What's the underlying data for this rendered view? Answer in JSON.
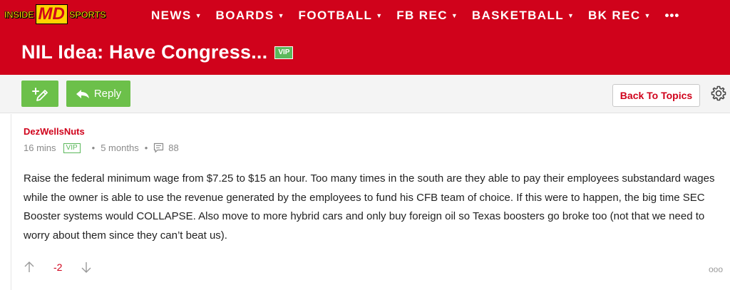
{
  "logo": {
    "left": "INSIDE",
    "mark": "MD",
    "right": "SPORTS"
  },
  "nav": {
    "items": [
      {
        "label": "NEWS"
      },
      {
        "label": "BOARDS"
      },
      {
        "label": "FOOTBALL"
      },
      {
        "label": "FB REC"
      },
      {
        "label": "BASKETBALL"
      },
      {
        "label": "BK REC"
      }
    ],
    "more_label": "•••"
  },
  "topic": {
    "title": "NIL Idea: Have Congress...",
    "badge": "VIP"
  },
  "toolbar": {
    "reply_label": "Reply",
    "back_label": "Back To Topics",
    "new_icon": "new-post-icon",
    "settings_icon": "gear-icon"
  },
  "post": {
    "author": "DezWellsNuts",
    "time": "16 mins",
    "badge": "VIP",
    "member_for": "5 months",
    "post_count": "88",
    "body": "Raise the federal minimum wage from $7.25 to $15 an hour. Too many times in the south are they able to pay their employees substandard wages while the owner is able to use the revenue generated by the employees to fund his CFB team of choice. If this were to happen, the big time SEC Booster systems would COLLAPSE. Also move to more hybrid cars and only buy foreign oil so Texas boosters go broke too (not that we need to worry about them since they can’t beat us).",
    "score": "-2",
    "more_label": "ooo"
  },
  "colors": {
    "brand": "#d0021b",
    "accent_green": "#6cc04a",
    "vip_green": "#5cb85c",
    "logo_yellow": "#ffd200"
  }
}
